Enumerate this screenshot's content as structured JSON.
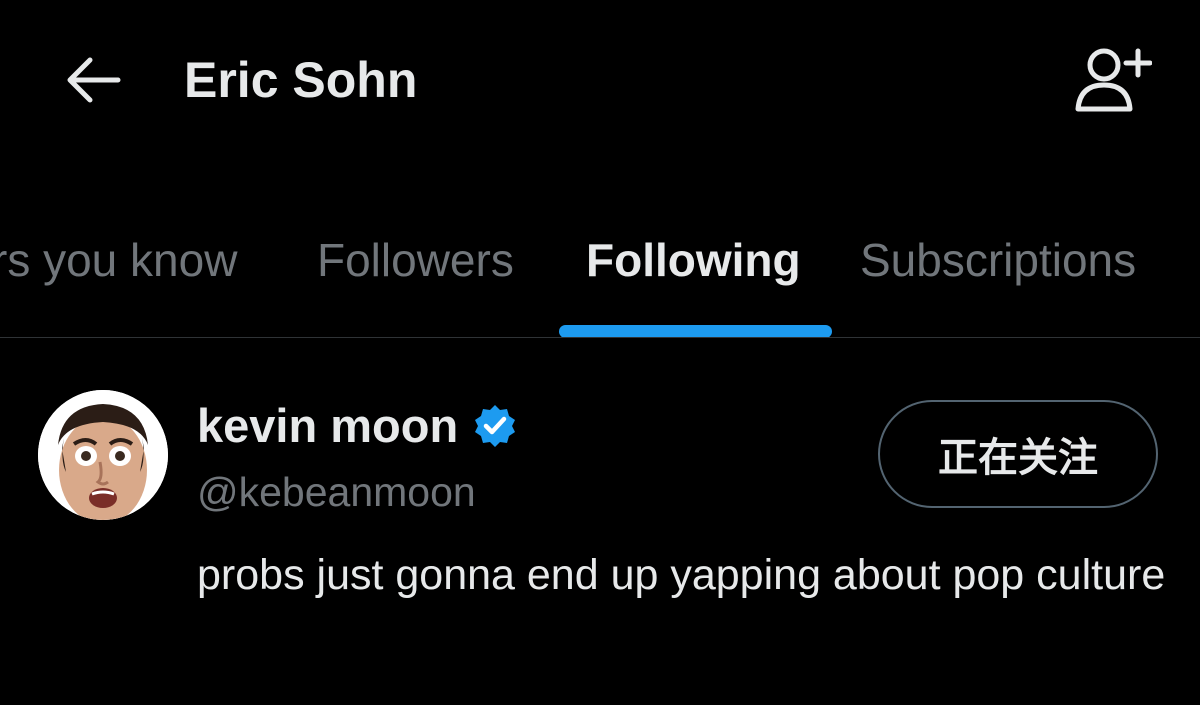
{
  "header": {
    "back_icon": "arrow-left-icon",
    "title": "Eric Sohn",
    "add_user_icon": "person-plus-icon"
  },
  "tabs": [
    {
      "label": "rs you know",
      "active": false
    },
    {
      "label": "Followers",
      "active": false
    },
    {
      "label": "Following",
      "active": true
    },
    {
      "label": "Subscriptions",
      "active": false
    }
  ],
  "colors": {
    "background": "#000000",
    "primary_text": "#e7e9ea",
    "secondary_text": "#71767b",
    "accent": "#1d9bf0",
    "divider": "#2f3336",
    "button_border": "#536471"
  },
  "user": {
    "avatar_icon": "avatar-photo",
    "name": "kevin moon",
    "verified_icon": "verified-badge-icon",
    "handle": "@kebeanmoon",
    "follow_button_label": "正在关注",
    "bio": "probs just gonna end up yapping about pop culture"
  }
}
